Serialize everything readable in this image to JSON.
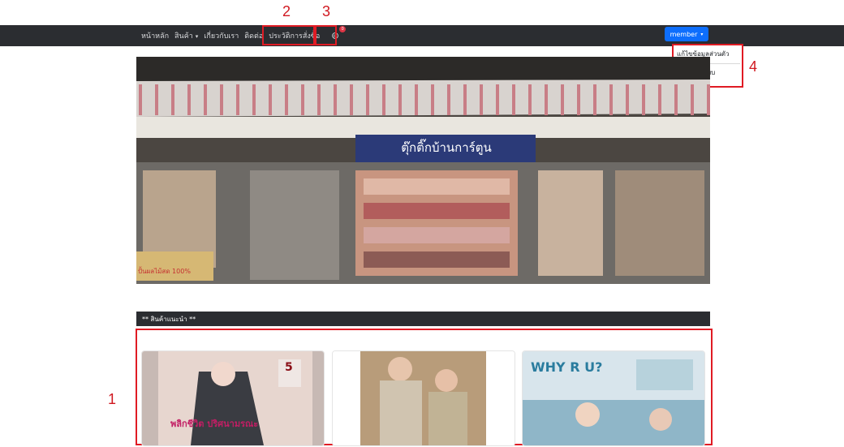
{
  "navbar": {
    "items": [
      {
        "label": "หน้าหลัก",
        "dropdown": false
      },
      {
        "label": "สินค้า",
        "dropdown": true
      },
      {
        "label": "เกี่ยวกับเรา",
        "dropdown": false
      },
      {
        "label": "ติดต่อ",
        "dropdown": false
      },
      {
        "label": "ประวัติการสั่งซื้อ",
        "dropdown": false
      }
    ],
    "cart_icon": "cart-icon",
    "cart_badge": "0",
    "user_button": "member",
    "user_caret": "▾",
    "nav_caret": "▾"
  },
  "user_menu": {
    "items": [
      "แก้ไขข้อมูลส่วนตัว",
      "ออกจากระบบ"
    ]
  },
  "hero": {
    "shop_sign": "ตุ๊กติ๊กบ้านการ์ตูน",
    "left_sign": "ปั้นผลไม้สด 100%"
  },
  "products_section": {
    "title": "** สินค้าแนะนำ **",
    "cards": [
      {
        "title": "พลิกชีวิต ปริศนามรณะ",
        "badge": "5"
      },
      {
        "title": "",
        "badge": ""
      },
      {
        "title": "WHY R U?",
        "badge": ""
      }
    ]
  },
  "annotations": [
    "1",
    "2",
    "3",
    "4"
  ],
  "colors": {
    "navbar": "#2b2d31",
    "primary": "#0d6efd",
    "annotation_red": "#e01b24"
  }
}
